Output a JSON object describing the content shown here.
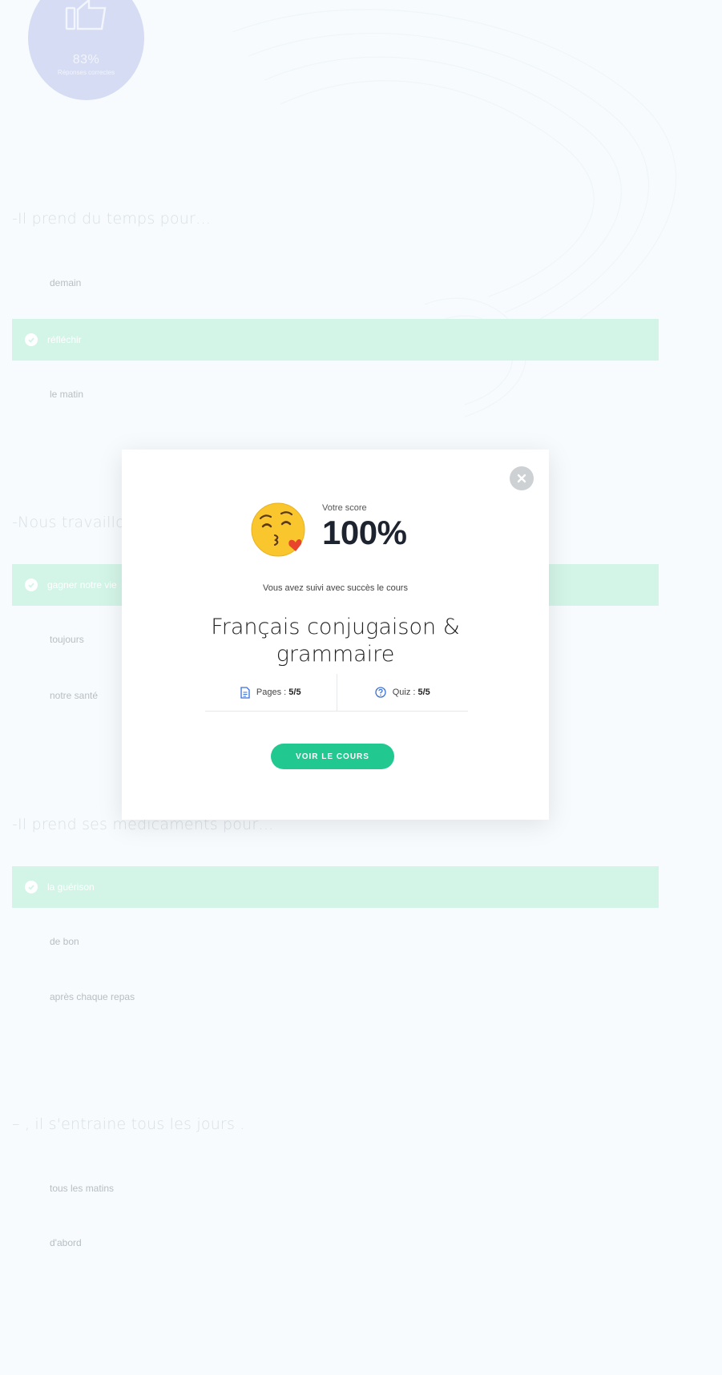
{
  "score_badge": {
    "percent": "83%",
    "label": "Réponses correctes"
  },
  "questions": [
    {
      "text": "-Il prend du temps pour…",
      "answers": [
        {
          "text": "demain",
          "correct": false
        },
        {
          "text": "réfléchir",
          "correct": true
        },
        {
          "text": "le matin",
          "correct": false
        }
      ]
    },
    {
      "text": "-Nous travaillons pour…",
      "answers": [
        {
          "text": "gagner notre vie",
          "correct": true
        },
        {
          "text": "toujours",
          "correct": false
        },
        {
          "text": "notre santé",
          "correct": false
        }
      ]
    },
    {
      "text": "-Il prend ses médicaments pour…",
      "answers": [
        {
          "text": "la guérison",
          "correct": true
        },
        {
          "text": "de bon",
          "correct": false
        },
        {
          "text": "après chaque repas",
          "correct": false
        }
      ]
    },
    {
      "text": "– , il s'entraine tous les jours .",
      "answers": [
        {
          "text": "tous les matins",
          "correct": false
        },
        {
          "text": "d'abord",
          "correct": false
        }
      ]
    }
  ],
  "modal": {
    "score_label": "Votre score",
    "score_value": "100%",
    "subtitle": "Vous avez suivi avec succès le cours",
    "course_title": "Français conjugaison & grammaire",
    "pages_label": "Pages : ",
    "pages_value": "5/5",
    "quiz_label": "Quiz : ",
    "quiz_value": "5/5",
    "cta_label": "VOIR LE COURS",
    "emoji": "kissing-face-icon"
  },
  "colors": {
    "accent": "#21c990",
    "correct_bg": "#d3f5e8",
    "badge_bg": "#d5dcf3",
    "icon_blue": "#3a6fd8"
  }
}
